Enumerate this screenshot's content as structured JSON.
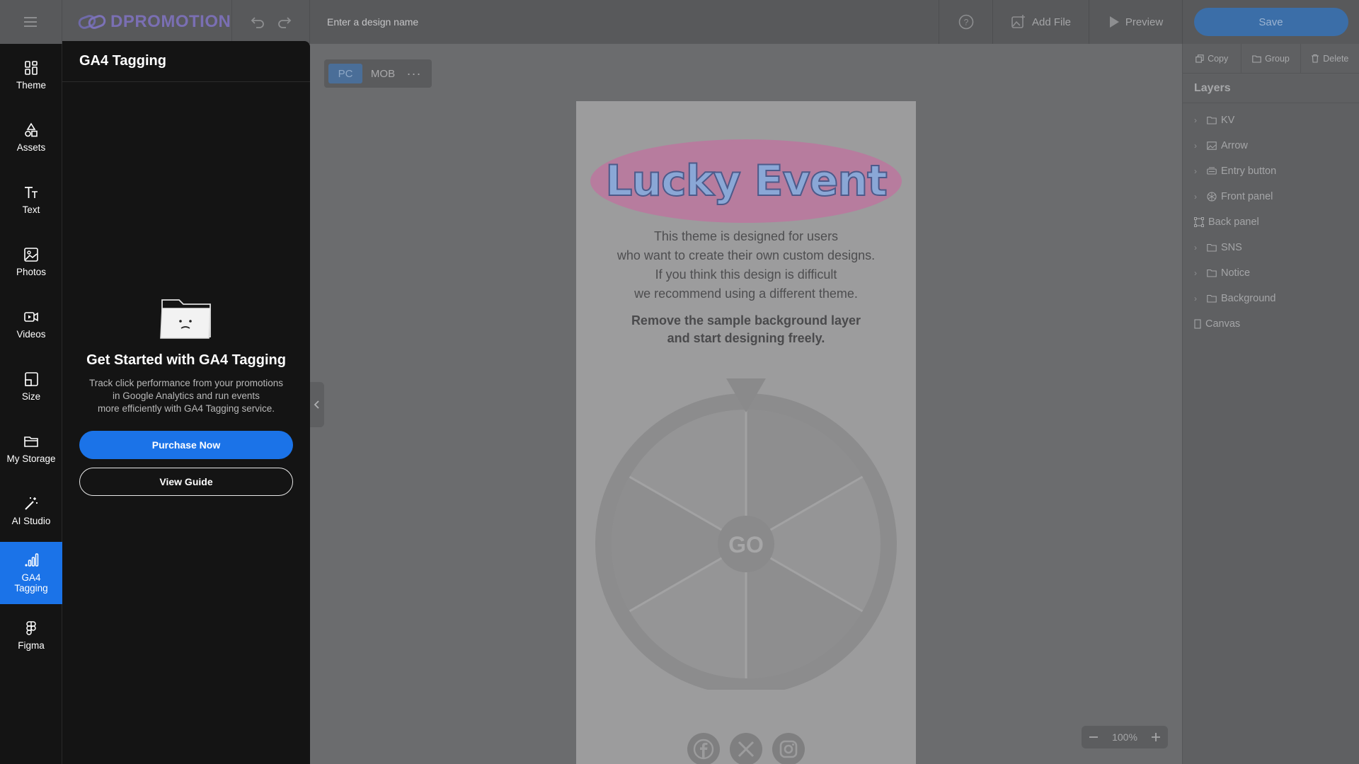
{
  "topbar": {
    "brand": "DPROMOTION",
    "design_name_placeholder": "Enter a design name",
    "add_file_label": "Add File",
    "preview_label": "Preview",
    "save_label": "Save"
  },
  "rail": [
    {
      "label": "Theme",
      "icon": "theme-icon"
    },
    {
      "label": "Assets",
      "icon": "assets-icon"
    },
    {
      "label": "Text",
      "icon": "text-icon"
    },
    {
      "label": "Photos",
      "icon": "photo-icon"
    },
    {
      "label": "Videos",
      "icon": "video-icon"
    },
    {
      "label": "Size",
      "icon": "size-icon"
    },
    {
      "label": "My Storage",
      "icon": "folder-icon"
    },
    {
      "label": "AI Studio",
      "icon": "magic-wand-icon"
    },
    {
      "label": "GA4 Tagging",
      "icon": "bar-chart-icon",
      "active": true
    },
    {
      "label": "Figma",
      "icon": "figma-icon"
    }
  ],
  "panel": {
    "title": "GA4 Tagging",
    "empty_title": "Get Started with GA4 Tagging",
    "empty_desc_1": "Track click performance from your promotions",
    "empty_desc_2": "in Google Analytics and run events",
    "empty_desc_3": "more efficiently with GA4 Tagging service.",
    "purchase_label": "Purchase Now",
    "guide_label": "View Guide"
  },
  "device": {
    "pc": "PC",
    "mob": "MOB",
    "more": "···",
    "selected": "PC"
  },
  "canvas": {
    "kv_title": "Lucky Event",
    "desc_lines": [
      "This theme is designed for users",
      "who want to create their own custom designs.",
      "If you think this design is difficult",
      "we recommend using a different theme."
    ],
    "bold_lines": [
      "Remove the sample background layer",
      "and start designing freely."
    ],
    "wheel_center": "GO",
    "sns": [
      "facebook-icon",
      "x-icon",
      "instagram-icon"
    ]
  },
  "zoom": {
    "value": "100%"
  },
  "right": {
    "actions": [
      {
        "label": "Copy",
        "icon": "copy-icon"
      },
      {
        "label": "Group",
        "icon": "folder-icon"
      },
      {
        "label": "Delete",
        "icon": "trash-icon"
      }
    ],
    "layers_title": "Layers",
    "layers": [
      {
        "label": "KV",
        "icon": "folder-icon",
        "expandable": true
      },
      {
        "label": "Arrow",
        "icon": "image-icon",
        "expandable": true
      },
      {
        "label": "Entry button",
        "icon": "button-icon",
        "expandable": true
      },
      {
        "label": "Front panel",
        "icon": "spinner-icon",
        "expandable": true
      },
      {
        "label": "Back panel",
        "icon": "frame-icon",
        "expandable": false
      },
      {
        "label": "SNS",
        "icon": "folder-icon",
        "expandable": true
      },
      {
        "label": "Notice",
        "icon": "folder-icon",
        "expandable": true
      },
      {
        "label": "Background",
        "icon": "folder-icon",
        "expandable": true
      },
      {
        "label": "Canvas",
        "icon": "canvas-icon",
        "expandable": false
      }
    ]
  },
  "colors": {
    "accent": "#1b73e8",
    "panel_bg": "#141414",
    "overlay_bg": "#6b6c6e"
  }
}
